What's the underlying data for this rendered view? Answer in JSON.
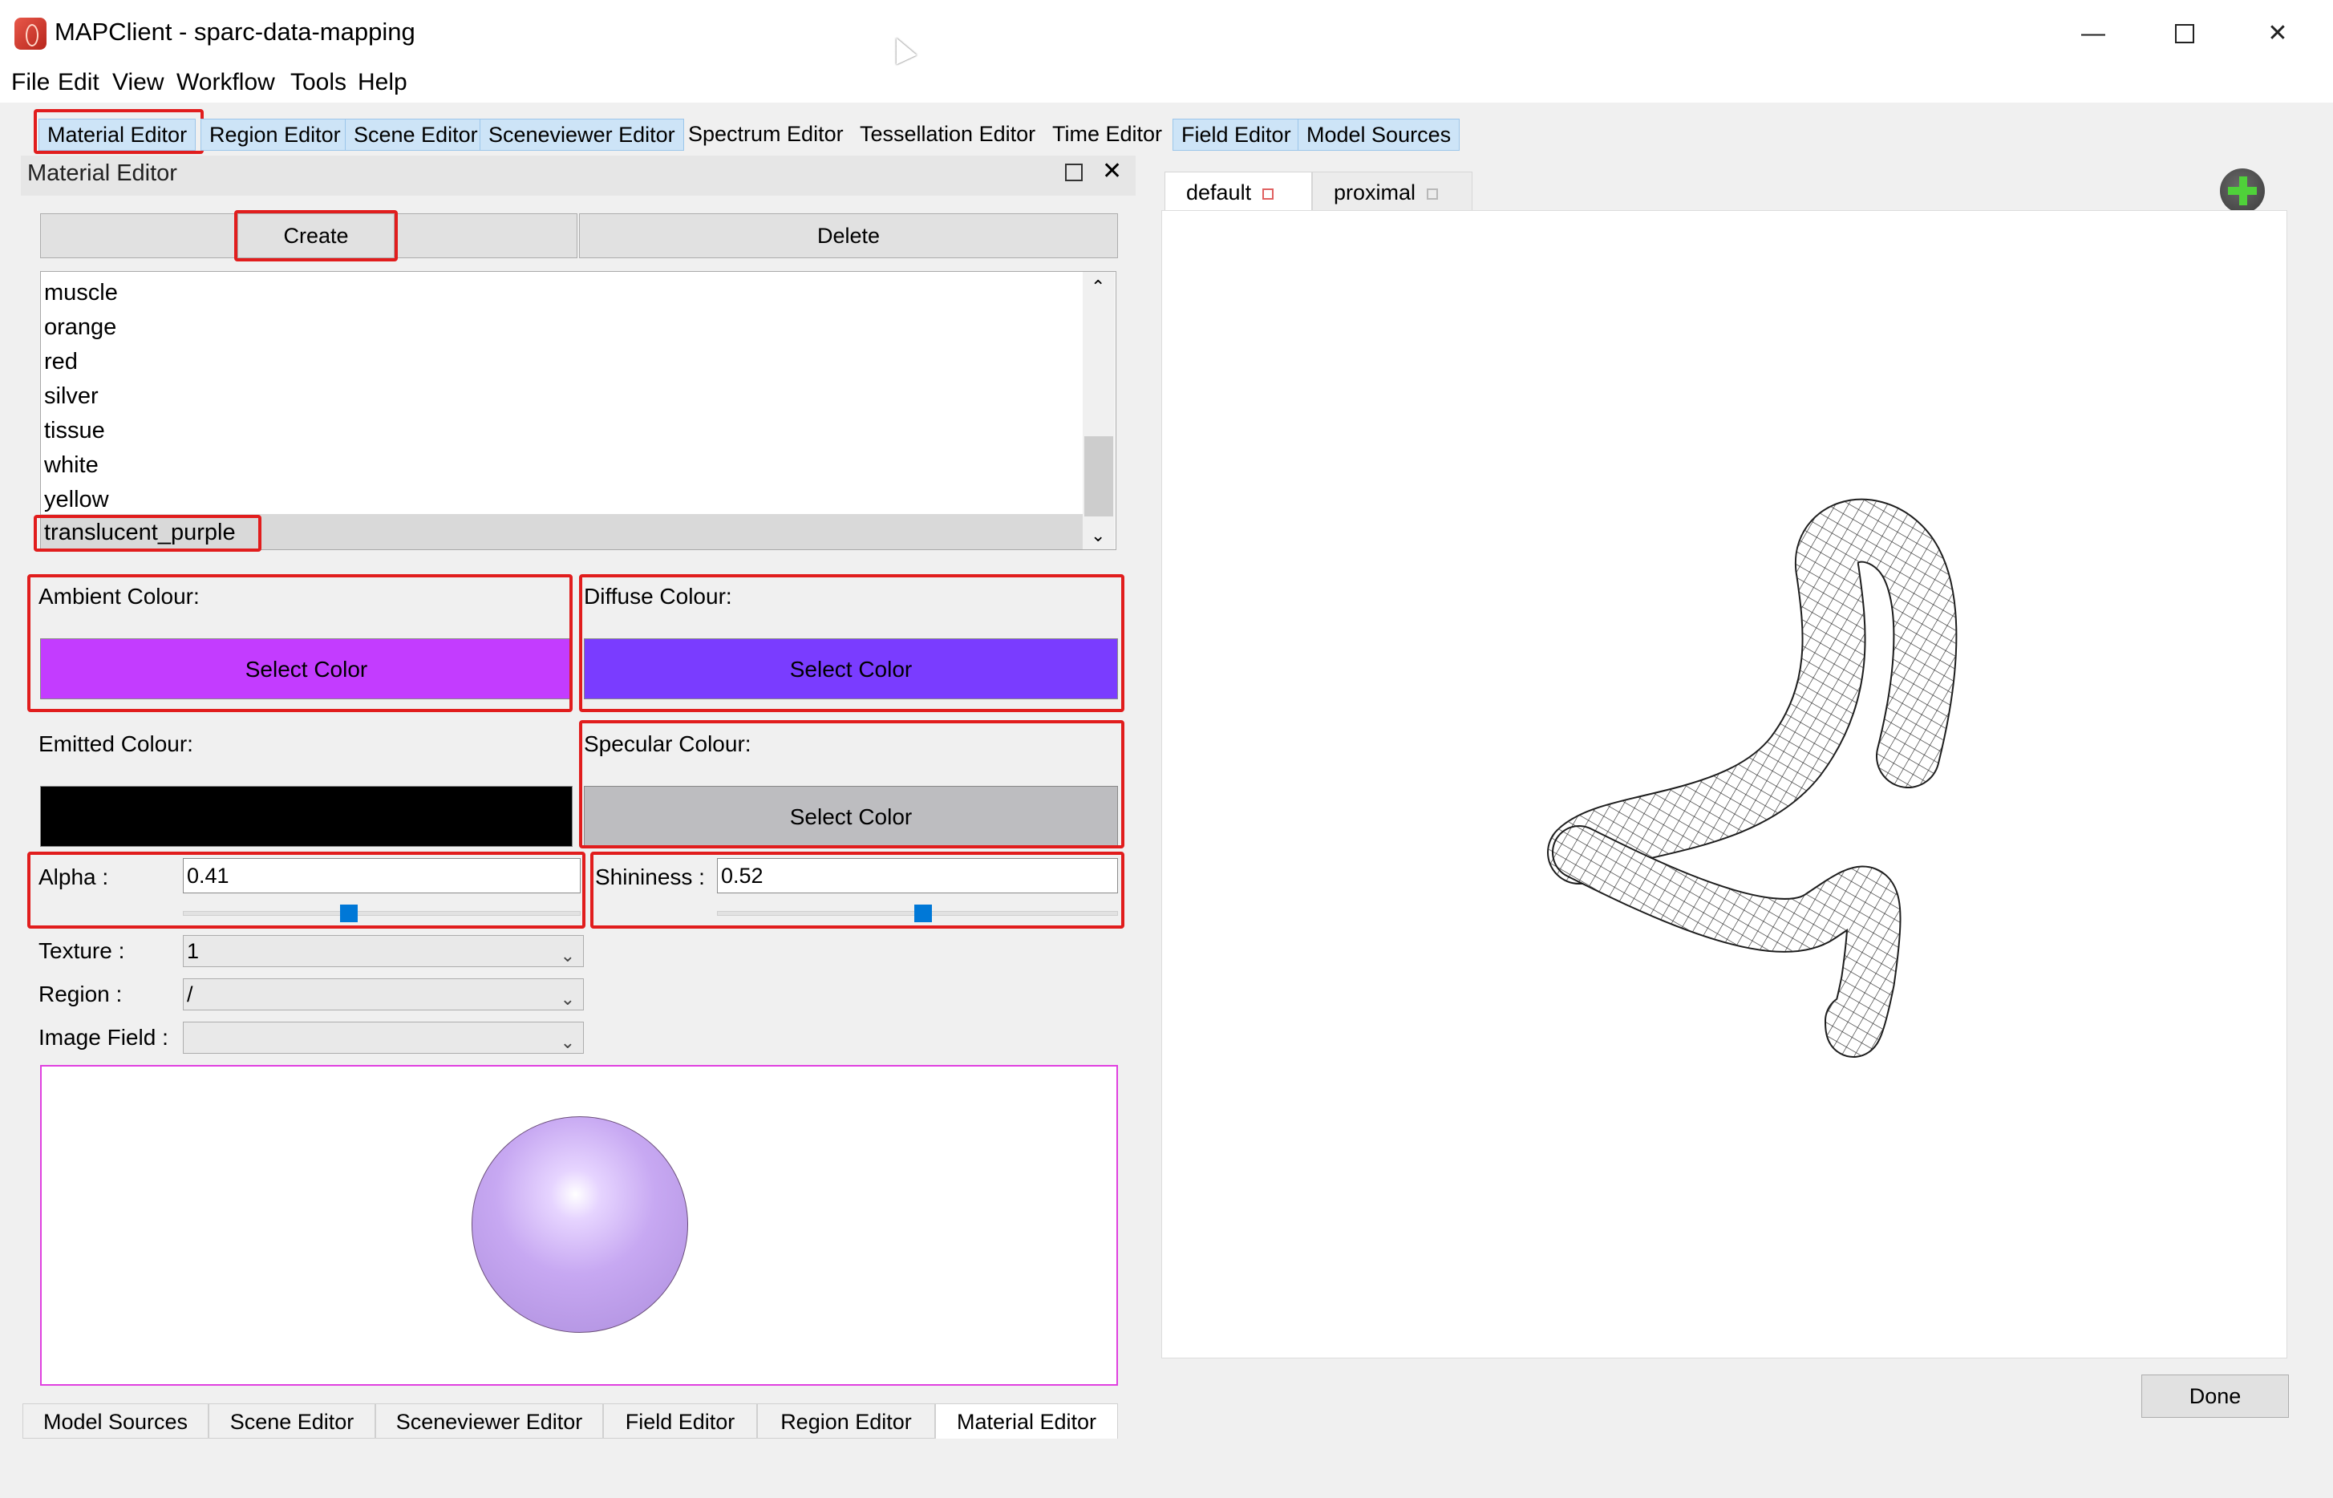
{
  "window": {
    "title": "MAPClient - sparc-data-mapping",
    "minimize_icon": "minimize-icon",
    "maximize_icon": "maximize-icon",
    "close_icon": "close-icon"
  },
  "menu": [
    "File",
    "Edit",
    "View",
    "Workflow",
    "Tools",
    "Help"
  ],
  "toolbar_tabs": [
    "Material Editor",
    "Region Editor",
    "Scene Editor",
    "Sceneviewer Editor",
    "Spectrum Editor",
    "Tessellation Editor",
    "Time Editor",
    "Field Editor",
    "Model Sources"
  ],
  "material_editor": {
    "title": "Material Editor",
    "create_label": "Create",
    "delete_label": "Delete",
    "materials": [
      "muscle",
      "orange",
      "red",
      "silver",
      "tissue",
      "white",
      "yellow",
      "translucent_purple"
    ],
    "selected_material": "translucent_purple",
    "ambient": {
      "label": "Ambient Colour:",
      "button": "Select Color",
      "color": "#c33cff"
    },
    "diffuse": {
      "label": "Diffuse Colour:",
      "button": "Select Color",
      "color": "#7a3cff"
    },
    "emitted": {
      "label": "Emitted Colour:",
      "color": "#000000"
    },
    "specular": {
      "label": "Specular Colour:",
      "button": "Select Color",
      "color": "#bdbdc0"
    },
    "alpha": {
      "label": "Alpha :",
      "value": "0.41",
      "slider_fraction": 0.41
    },
    "shininess": {
      "label": "Shininess :",
      "value": "0.52",
      "slider_fraction": 0.52
    },
    "texture": {
      "label": "Texture :",
      "value": "1"
    },
    "region": {
      "label": "Region :",
      "value": "/"
    },
    "image_field": {
      "label": "Image Field :",
      "value": ""
    }
  },
  "bottom_tabs": [
    "Model Sources",
    "Scene Editor",
    "Sceneviewer Editor",
    "Field Editor",
    "Region Editor",
    "Material Editor"
  ],
  "active_bottom_tab": "Material Editor",
  "view_tabs": [
    "default",
    "proximal"
  ],
  "done_label": "Done",
  "colors": {
    "highlight_box": "#e11d1d",
    "tab_highlight": "#cde4f7",
    "slider": "#0078d7",
    "preview_border": "#e040e0"
  }
}
